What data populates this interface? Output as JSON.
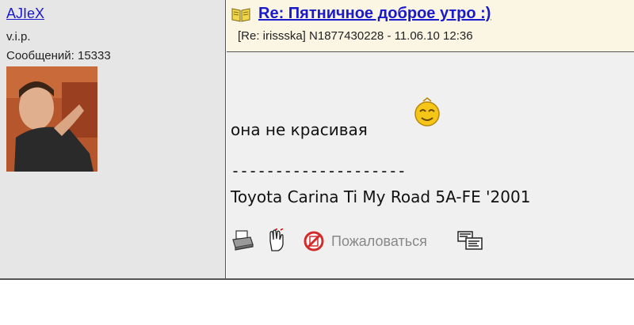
{
  "author": {
    "username": "AJIeX",
    "rank": "v.i.p.",
    "messages_label": "Сообщений: 15333"
  },
  "post": {
    "title": "Re: Пятничное доброе утро :)",
    "meta": "[Re: irissska]  N1877430228 - 11.06.10 12:36",
    "body": "она не красивая",
    "signature_separator": "--------------------",
    "signature": "Toyota Carina Ti My Road 5A-FE '2001"
  },
  "actions": {
    "report_label": "Пожаловаться",
    "icons": [
      "printer-icon",
      "reply-hand-icon",
      "no-entry-icon",
      "report-label",
      "thread-view-icon"
    ]
  },
  "colors": {
    "link": "#1a1acc",
    "header_bg": "#fbf6e4",
    "sidebar_bg": "#e6e6e6",
    "body_bg": "#f0f0f0"
  }
}
